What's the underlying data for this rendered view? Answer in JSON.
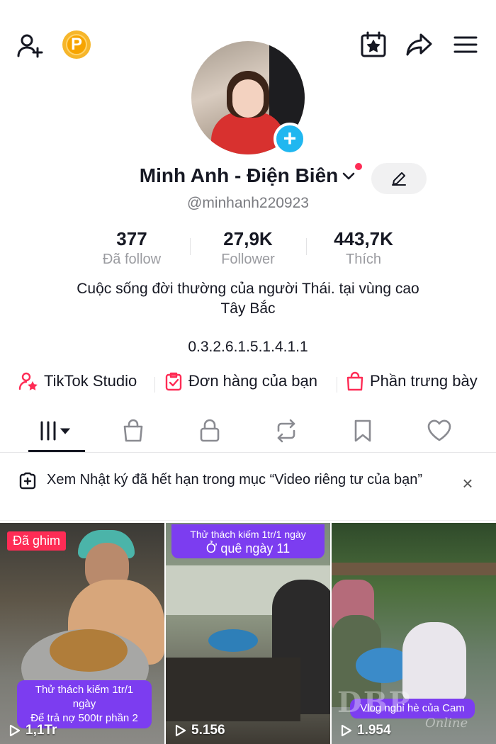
{
  "top_bar": {
    "add_friend_icon": "person-plus-icon",
    "coin_label": "P",
    "calendar_icon": "calendar-star-icon",
    "share_icon": "share-arrow-icon",
    "menu_icon": "hamburger-menu-icon"
  },
  "profile": {
    "display_name": "Minh Anh - Điện Biên",
    "username": "@minhanh220923",
    "avatar_add_label": "+",
    "bio_line1": "Cuộc sống đời thường của người Thái. tại vùng cao",
    "bio_line2": "Tây Bắc",
    "link_text": "0.3.2.6.1.5.1.4.1.1"
  },
  "stats": {
    "following": {
      "value": "377",
      "label": "Đã follow"
    },
    "followers": {
      "value": "27,9K",
      "label": "Follower"
    },
    "likes": {
      "value": "443,7K",
      "label": "Thích"
    }
  },
  "shortcuts": {
    "studio": "TikTok Studio",
    "orders": "Đơn hàng của bạn",
    "showcase": "Phần trưng bày"
  },
  "notice": {
    "text": "Xem Nhật ký đã hết hạn trong mục “Video riêng tư của bạn”",
    "close": "×"
  },
  "videos": [
    {
      "badge": "Đã ghim",
      "caption_line1": "Thử thách kiếm 1tr/1 ngày",
      "caption_line2": "Để trả nợ 500tr phần 2",
      "views": "1,1Tr"
    },
    {
      "caption_line1": "Thử thách kiếm 1tr/1 ngày",
      "caption_line2": "Ở quê ngày 11",
      "views": "5.156"
    },
    {
      "caption_line1": "Vlog nghỉ hè của Cam",
      "views": "1.954"
    }
  ],
  "watermark": {
    "main": "DBP",
    "sub": "Online"
  },
  "colors": {
    "accent": "#fe2c55",
    "blue": "#20b7f0",
    "coin": "#f7a400",
    "caption": "#7c3df0"
  }
}
